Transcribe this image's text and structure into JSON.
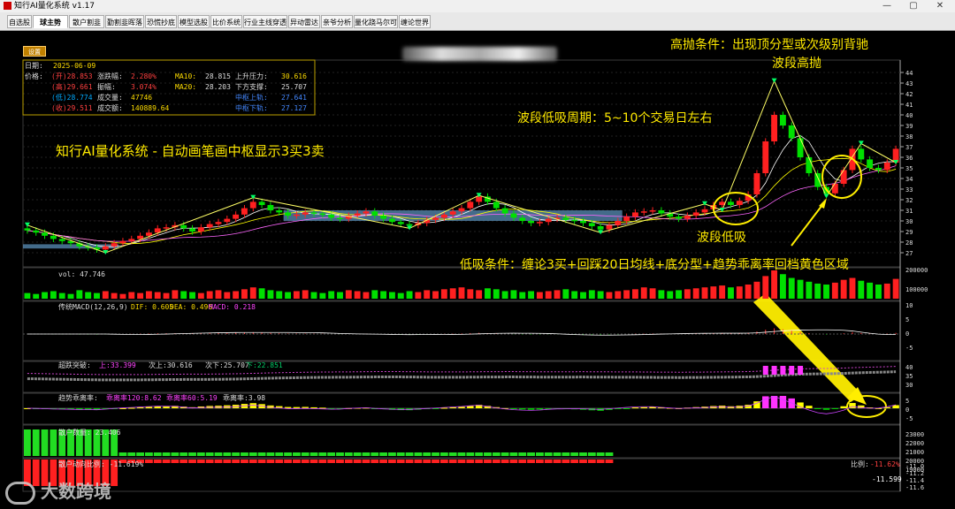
{
  "window": {
    "title": "知行AI量化系统 v1.17",
    "controls": [
      "—",
      "▢",
      "✕"
    ]
  },
  "tabs": [
    "自选股",
    "球主势",
    "散户割韭",
    "勤割韭晖落",
    "恐慌抄底",
    "模型选股",
    "比价系统",
    "行业主线穿透",
    "异动雷达",
    "亲爷分析",
    "量化跷马尔可夫",
    "缠论世界"
  ],
  "active_tab": 1,
  "toolbar": {
    "settings_label": "设置"
  },
  "info": {
    "date_label": "日期:",
    "date": "2025-06-09",
    "price_label": "价格:",
    "open": "(开)28.853",
    "high": "(高)29.661",
    "low": "(低)28.774",
    "close": "(收)29.511",
    "rise_fall_label": "涨跌幅:",
    "rise_fall": "2.280%",
    "amplitude_label": "振幅:",
    "amplitude": "3.074%",
    "volume_label": "成交量:",
    "volume": "47746",
    "turnover_label": "成交额:",
    "turnover": "140889.64",
    "ma10_label": "MA10:",
    "ma10": "28.815",
    "ma20_label": "MA20:",
    "ma20": "28.203",
    "resistance_label": "上升压力:",
    "resistance": "30.616",
    "support_label": "下方支撑:",
    "support": "25.707",
    "center_upper_label": "中枢上轨:",
    "center_upper": "27.641",
    "center_lower_label": "中枢下轨:",
    "center_lower": "27.127"
  },
  "annotations": {
    "main_title": "知行AI量化系统 - 自动画笔画中枢显示3买3卖",
    "high_sell_1": "高抛条件：出现顶分型或次级别背驰",
    "high_sell_2": "波段高抛",
    "cycle": "波段低吸周期：5~10个交易日左右",
    "low_buy": "波段低吸",
    "low_buy_cond": "低吸条件：缠论3买+回踩20日均线+底分型+趋势乖离率回档黄色区域"
  },
  "price_axis": [
    "44",
    "43",
    "42",
    "41",
    "40",
    "39",
    "38",
    "37",
    "36",
    "35",
    "34",
    "33",
    "32",
    "31",
    "30",
    "29",
    "28",
    "27"
  ],
  "vol_panel": {
    "label": "vol: 47.746",
    "ticks": [
      "200000",
      "100000"
    ]
  },
  "macd_panel": {
    "name": "传统MACD(12,26,9)",
    "dif": "DIF: 0.605",
    "dea": "DEA: 0.496",
    "macd": "MACD: 0.218",
    "ticks": [
      "10",
      "5",
      "0",
      "-5"
    ]
  },
  "break_panel": {
    "name": "超跌突破:",
    "v1": "上:33.399",
    "v2": "次上:30.616",
    "v3": "次下:25.707",
    "v4": "下:22.851",
    "ticks": [
      "40",
      "35",
      "30"
    ]
  },
  "bias_panel": {
    "name": "趋势乖离率:",
    "v1": "乖离率120:8.62",
    "v2": "乖离率60:5.19",
    "v3": "乖离率:3.98",
    "ticks": [
      "5",
      "0",
      "-5"
    ]
  },
  "retail_panel": {
    "label": "散户数量: 23.406",
    "ticks": [
      "23000",
      "22000",
      "21000",
      "20000",
      "19000"
    ]
  },
  "retail_ratio_panel": {
    "label": "散户动向比例: -11.619%",
    "ratio_label": "比例:",
    "ratio": "-11.62%",
    "value": "-11.599",
    "ticks": [
      "-11.0",
      "-11.2",
      "-11.4",
      "-11.6"
    ]
  },
  "watermark": "大数跨境",
  "colors": {
    "up": "#ff2020",
    "down": "#00e000",
    "annotation": "#ffea00",
    "center_box": "#5a8fb8"
  },
  "chart_data": {
    "type": "candlestick",
    "open": [
      29.3,
      29.1,
      28.9,
      28.6,
      28.3,
      28.1,
      27.9,
      27.6,
      27.5,
      27.3,
      27.6,
      27.9,
      28.1,
      28.3,
      28.6,
      28.9,
      29.3,
      29.4,
      29.6,
      29.3,
      29.0,
      29.4,
      29.7,
      29.9,
      30.2,
      30.6,
      31.2,
      31.8,
      31.5,
      31.0,
      30.8,
      30.5,
      30.6,
      30.8,
      30.7,
      30.6,
      30.3,
      30.2,
      30.5,
      30.7,
      30.9,
      30.5,
      30.2,
      29.9,
      29.7,
      29.6,
      29.8,
      30.1,
      30.3,
      30.6,
      30.9,
      31.2,
      31.8,
      32.3,
      31.8,
      31.2,
      30.7,
      30.3,
      30.0,
      29.8,
      29.9,
      30.2,
      30.3,
      30.1,
      30.0,
      29.8,
      29.5,
      29.2,
      29.6,
      30.0,
      30.4,
      30.8,
      30.9,
      31.0,
      30.7,
      30.4,
      30.2,
      30.5,
      30.8,
      31.1,
      31.5,
      31.8,
      31.5,
      31.9,
      32.5,
      34.5,
      37.5,
      40.0,
      39.0,
      37.8,
      36.0,
      34.5,
      33.2,
      32.6,
      33.5,
      34.8,
      36.8,
      35.8,
      35.0,
      34.8,
      35.5
    ],
    "close": [
      29.1,
      28.9,
      28.6,
      28.3,
      28.1,
      27.9,
      27.6,
      27.5,
      27.3,
      27.6,
      27.9,
      28.1,
      28.3,
      28.6,
      28.9,
      29.3,
      29.4,
      29.6,
      29.3,
      29.0,
      29.4,
      29.7,
      29.9,
      30.2,
      30.6,
      31.2,
      31.8,
      31.5,
      31.0,
      30.8,
      30.5,
      30.6,
      30.8,
      30.7,
      30.6,
      30.3,
      30.2,
      30.5,
      30.7,
      30.9,
      30.5,
      30.2,
      29.9,
      29.7,
      29.6,
      29.8,
      30.1,
      30.3,
      30.6,
      30.9,
      31.2,
      31.8,
      32.3,
      31.8,
      31.2,
      30.7,
      30.3,
      30.0,
      29.8,
      29.9,
      30.2,
      30.3,
      30.1,
      30.0,
      29.8,
      29.5,
      29.2,
      29.6,
      30.0,
      30.4,
      30.8,
      30.9,
      31.0,
      30.7,
      30.4,
      30.2,
      30.5,
      30.8,
      31.1,
      31.5,
      31.8,
      31.5,
      31.9,
      32.5,
      34.5,
      37.5,
      40.0,
      39.0,
      37.8,
      36.0,
      34.5,
      33.2,
      32.6,
      33.5,
      34.8,
      36.8,
      35.8,
      35.0,
      34.8,
      35.5,
      36.8
    ],
    "volume": [
      6,
      5,
      7,
      8,
      6,
      5,
      9,
      7,
      6,
      8,
      6,
      5,
      7,
      6,
      8,
      7,
      6,
      9,
      8,
      7,
      6,
      8,
      9,
      7,
      8,
      10,
      12,
      11,
      9,
      8,
      7,
      8,
      9,
      7,
      6,
      8,
      7,
      9,
      8,
      7,
      9,
      8,
      7,
      6,
      8,
      7,
      9,
      8,
      10,
      11,
      12,
      10,
      9,
      11,
      10,
      8,
      9,
      7,
      8,
      7,
      8,
      9,
      10,
      8,
      7,
      9,
      8,
      7,
      8,
      9,
      10,
      12,
      11,
      9,
      8,
      9,
      10,
      11,
      12,
      13,
      14,
      12,
      13,
      15,
      18,
      24,
      30,
      26,
      22,
      20,
      18,
      16,
      15,
      17,
      20,
      22,
      19,
      17,
      15,
      16,
      21
    ],
    "center_boxes": [
      [
        0,
        10,
        27.4,
        27.8
      ],
      [
        30,
        68,
        30.0,
        31.0
      ]
    ],
    "ylim": [
      26.5,
      44.5
    ]
  }
}
